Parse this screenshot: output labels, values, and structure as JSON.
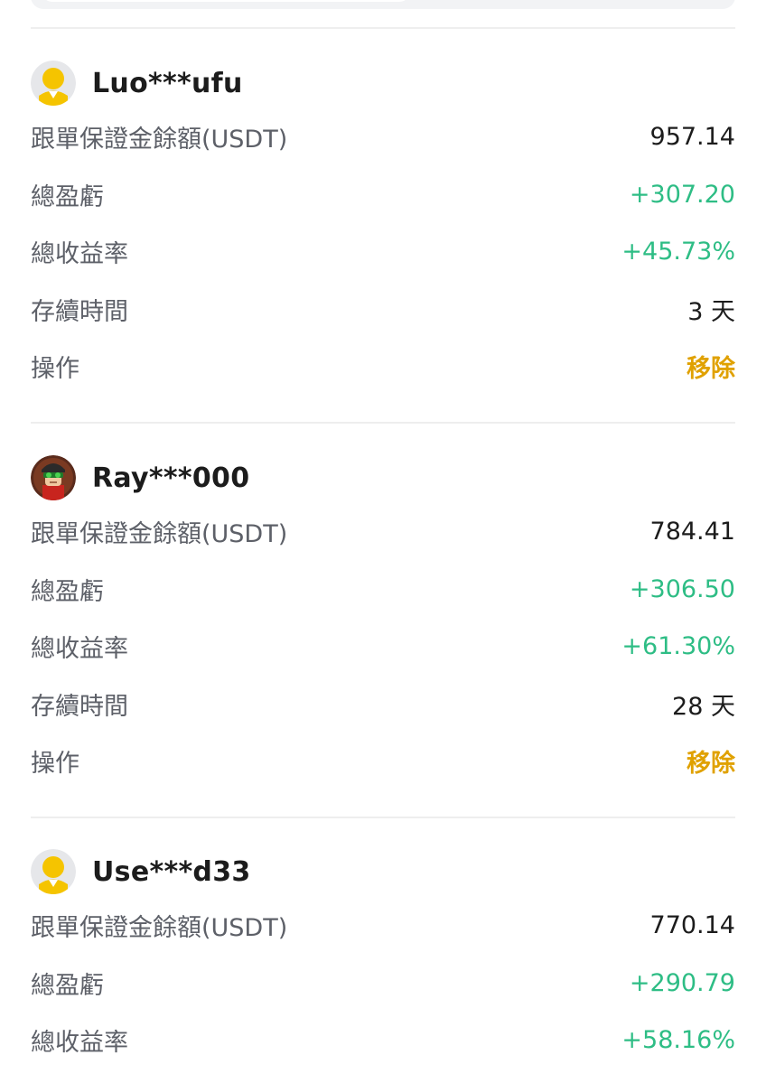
{
  "labels": {
    "margin_balance": "跟單保證金餘額(USDT)",
    "total_pnl": "總盈虧",
    "total_roi": "總收益率",
    "duration": "存續時間",
    "operation": "操作"
  },
  "colors": {
    "positive": "#2ebd85",
    "action": "#e0a100",
    "label": "#5d6068",
    "value": "#1c1c1c"
  },
  "traders": [
    {
      "name": "Luo***ufu",
      "avatar": "default-avatar-icon",
      "margin_balance": "957.14",
      "total_pnl": "+307.20",
      "total_roi": "+45.73%",
      "duration": "3 天",
      "action": "移除"
    },
    {
      "name": "Ray***000",
      "avatar": "custom-avatar-icon",
      "margin_balance": "784.41",
      "total_pnl": "+306.50",
      "total_roi": "+61.30%",
      "duration": "28 天",
      "action": "移除"
    },
    {
      "name": "Use***d33",
      "avatar": "default-avatar-icon",
      "margin_balance": "770.14",
      "total_pnl": "+290.79",
      "total_roi": "+58.16%"
    }
  ]
}
